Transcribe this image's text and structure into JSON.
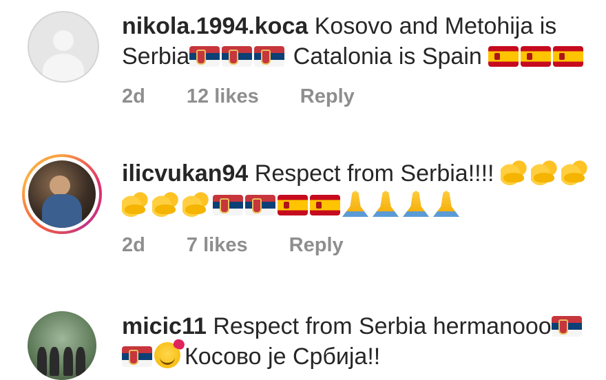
{
  "comments": [
    {
      "username": "nikola.1994.koca",
      "line1_text": "Kosovo and Metohija is",
      "line2_text_a": "Serbia",
      "line2_text_b": "Catalonia is Spain",
      "time": "2d",
      "likes": "12 likes",
      "reply": "Reply",
      "avatar": "default-avatar-icon"
    },
    {
      "username": "ilicvukan94",
      "line1_text": "Respect from Serbia!!!!",
      "time": "2d",
      "likes": "7 likes",
      "reply": "Reply",
      "avatar": "story-ring-photo"
    },
    {
      "username": "micic11",
      "line1_text": "Respect from Serbia hermanooo",
      "line2_text": "Косово је Србија!!",
      "avatar": "group-photo"
    }
  ],
  "colors": {
    "text": "#262626",
    "meta": "#8e8e8e"
  },
  "icons": [
    "serbia-flag-icon",
    "spain-flag-icon",
    "flexed-biceps-icon",
    "folded-hands-icon",
    "smiling-hearts-icon"
  ]
}
